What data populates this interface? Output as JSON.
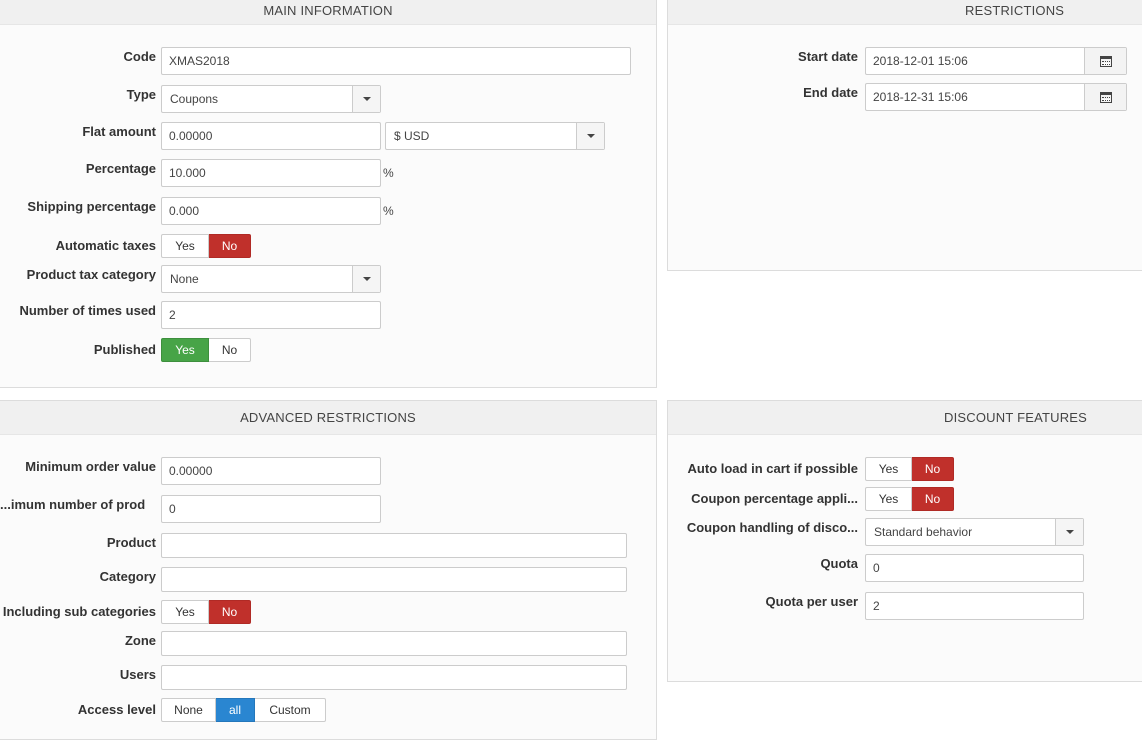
{
  "main": {
    "title": "Main information",
    "code": {
      "label": "Code",
      "value": "XMAS2018"
    },
    "type": {
      "label": "Type",
      "value": "Coupons"
    },
    "flat_amount": {
      "label": "Flat amount",
      "value": "0.00000",
      "currency": "$ USD"
    },
    "percentage": {
      "label": "Percentage",
      "value": "10.000",
      "suffix": "%"
    },
    "shipping_percentage": {
      "label": "Shipping percentage",
      "value": "0.000",
      "suffix": "%"
    },
    "automatic_taxes": {
      "label": "Automatic taxes",
      "yes": "Yes",
      "no": "No",
      "selected": "No"
    },
    "product_tax_category": {
      "label": "Product tax category",
      "value": "None"
    },
    "times_used": {
      "label": "Number of times used",
      "value": "2"
    },
    "published": {
      "label": "Published",
      "yes": "Yes",
      "no": "No",
      "selected": "Yes"
    }
  },
  "restrictions": {
    "title": "Restrictions",
    "start_date": {
      "label": "Start date",
      "value": "2018-12-01 15:06"
    },
    "end_date": {
      "label": "End date",
      "value": "2018-12-31 15:06"
    }
  },
  "advanced": {
    "title": "Advanced restrictions",
    "min_order": {
      "label": "Minimum order value",
      "value": "0.00000"
    },
    "min_products": {
      "label": "imum number of prod...",
      "value": "0"
    },
    "product": {
      "label": "Product",
      "value": ""
    },
    "category": {
      "label": "Category",
      "value": ""
    },
    "sub_categories": {
      "label": "Including sub categories",
      "yes": "Yes",
      "no": "No",
      "selected": "No"
    },
    "zone": {
      "label": "Zone",
      "value": ""
    },
    "users": {
      "label": "Users",
      "value": ""
    },
    "access_level": {
      "label": "Access level",
      "options": [
        "None",
        "all",
        "Custom"
      ],
      "selected": "all"
    }
  },
  "discount": {
    "title": "Discount features",
    "auto_load": {
      "label": "Auto load in cart if possible",
      "yes": "Yes",
      "no": "No",
      "selected": "No"
    },
    "coupon_percentage": {
      "label": "Coupon percentage appli...",
      "yes": "Yes",
      "no": "No",
      "selected": "No"
    },
    "coupon_handling": {
      "label": "Coupon handling of disco...",
      "value": "Standard behavior"
    },
    "quota": {
      "label": "Quota",
      "value": "0"
    },
    "quota_per_user": {
      "label": "Quota per user",
      "value": "2"
    }
  },
  "colors": {
    "no_active": "#c0302b",
    "yes_active": "#47a447",
    "selected_blue": "#2a86d1"
  }
}
